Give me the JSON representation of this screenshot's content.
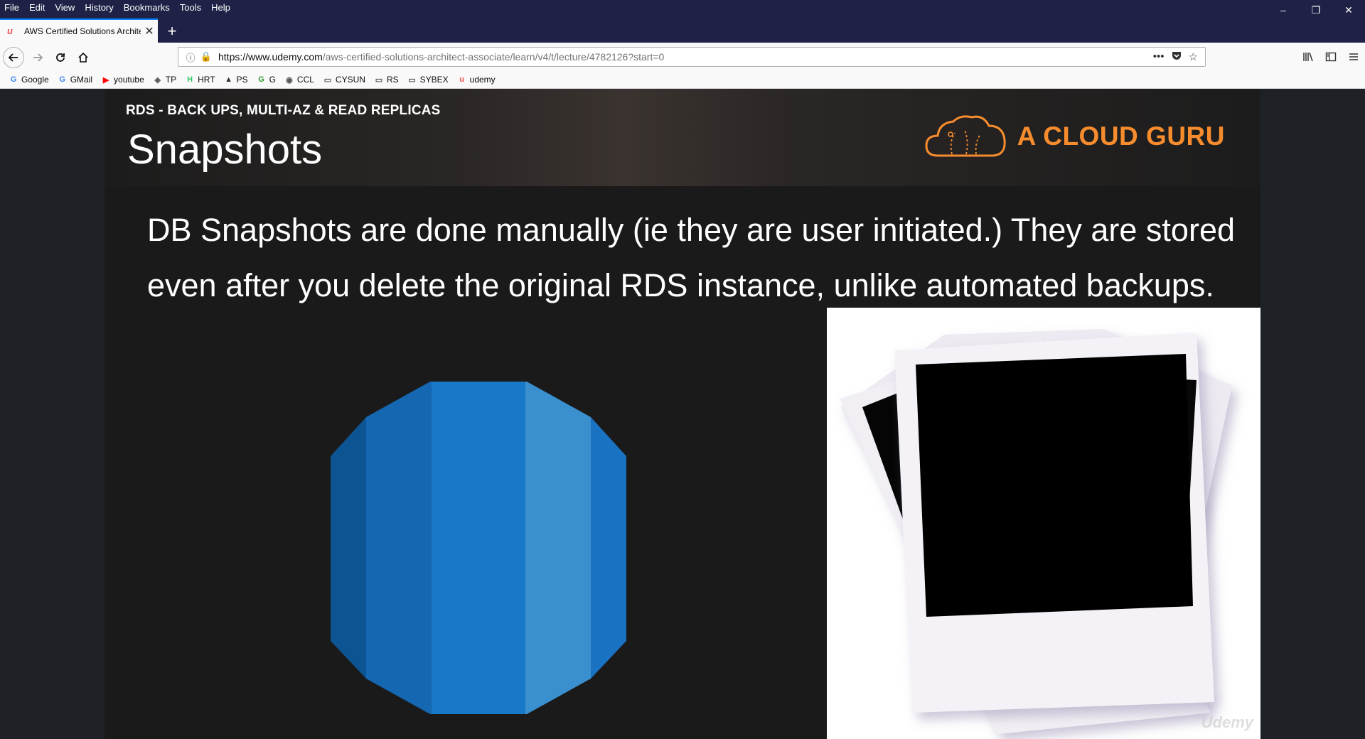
{
  "menubar": {
    "items": [
      "File",
      "Edit",
      "View",
      "History",
      "Bookmarks",
      "Tools",
      "Help"
    ]
  },
  "window_controls": {
    "minimize": "–",
    "restore": "❐",
    "close": "✕"
  },
  "tab": {
    "title": "AWS Certified Solutions Archite",
    "favicon": "udemy-icon",
    "close": "✕",
    "new_tab": "+"
  },
  "navbar": {
    "url_domain": "https://www.udemy.com",
    "url_path": "/aws-certified-solutions-architect-associate/learn/v4/t/lecture/4782126?start=0",
    "page_actions": "•••"
  },
  "bookmarks": [
    {
      "label": "Google",
      "icon": "google-icon",
      "color": "#4285f4",
      "glyph": "G"
    },
    {
      "label": "GMail",
      "icon": "google-icon",
      "color": "#4285f4",
      "glyph": "G"
    },
    {
      "label": "youtube",
      "icon": "youtube-icon",
      "color": "#ff0000",
      "glyph": "▶"
    },
    {
      "label": "TP",
      "icon": "tp-icon",
      "color": "#555555",
      "glyph": "◈"
    },
    {
      "label": "HRT",
      "icon": "hackerrank-icon",
      "color": "#2ec866",
      "glyph": "H"
    },
    {
      "label": "PS",
      "icon": "ps-icon",
      "color": "#333333",
      "glyph": "▲"
    },
    {
      "label": "G",
      "icon": "g-icon",
      "color": "#2b9a2b",
      "glyph": "G"
    },
    {
      "label": "CCL",
      "icon": "ccl-icon",
      "color": "#555555",
      "glyph": "◉"
    },
    {
      "label": "CYSUN",
      "icon": "folder-icon",
      "color": "#555555",
      "glyph": "▭"
    },
    {
      "label": "RS",
      "icon": "folder-icon",
      "color": "#555555",
      "glyph": "▭"
    },
    {
      "label": "SYBEX",
      "icon": "folder-icon",
      "color": "#555555",
      "glyph": "▭"
    },
    {
      "label": "udemy",
      "icon": "udemy-icon",
      "color": "#ec5252",
      "glyph": "u"
    }
  ],
  "slide": {
    "subtitle": "RDS - BACK UPS, MULTI-AZ & READ REPLICAS",
    "title": "Snapshots",
    "brand": "A CLOUD GURU",
    "body": "DB Snapshots are done manually (ie they are user initiated.) They are stored even after you delete the original RDS instance, unlike automated backups.",
    "watermark": "Udemy"
  },
  "colors": {
    "chrome_dark": "#1f2147",
    "brand_orange": "#f68c2e",
    "db_blue_dark": "#0f5a99",
    "db_blue_mid": "#1a73c2",
    "db_blue_light": "#3b8ecf"
  }
}
